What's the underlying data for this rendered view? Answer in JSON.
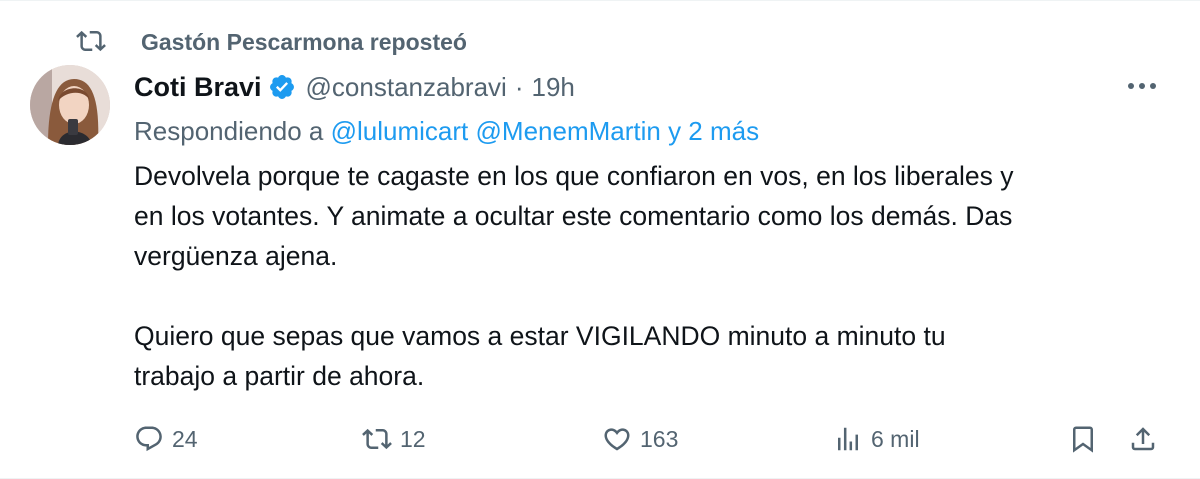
{
  "repost": {
    "label": "Gastón Pescarmona reposteó",
    "icon": "repost-icon"
  },
  "author": {
    "display_name": "Coti Bravi",
    "handle": "@constanzabravi",
    "separator": "·",
    "time": "19h",
    "verified": true,
    "verified_color": "#1d9bf0"
  },
  "replying": {
    "prefix": "Respondiendo a",
    "mentions": [
      "@lulumicart",
      "@MenemMartin"
    ],
    "more": "y 2 más"
  },
  "body": {
    "paragraph1_line1": "Devolvela porque te cagaste en los que confiaron en vos, en los liberales y",
    "paragraph1_line2": "en los votantes. Y animate a ocultar este comentario como los demás. Das",
    "paragraph1_line3": "vergüenza ajena.",
    "paragraph2_line1": "Quiero que sepas que vamos a estar VIGILANDO minuto a minuto tu",
    "paragraph2_line2": "trabajo a partir de ahora."
  },
  "actions": {
    "replies": "24",
    "reposts": "12",
    "likes": "163",
    "views": "6 mil"
  },
  "colors": {
    "text_primary": "#0f1419",
    "text_secondary": "#536471",
    "link": "#1d9bf0"
  }
}
